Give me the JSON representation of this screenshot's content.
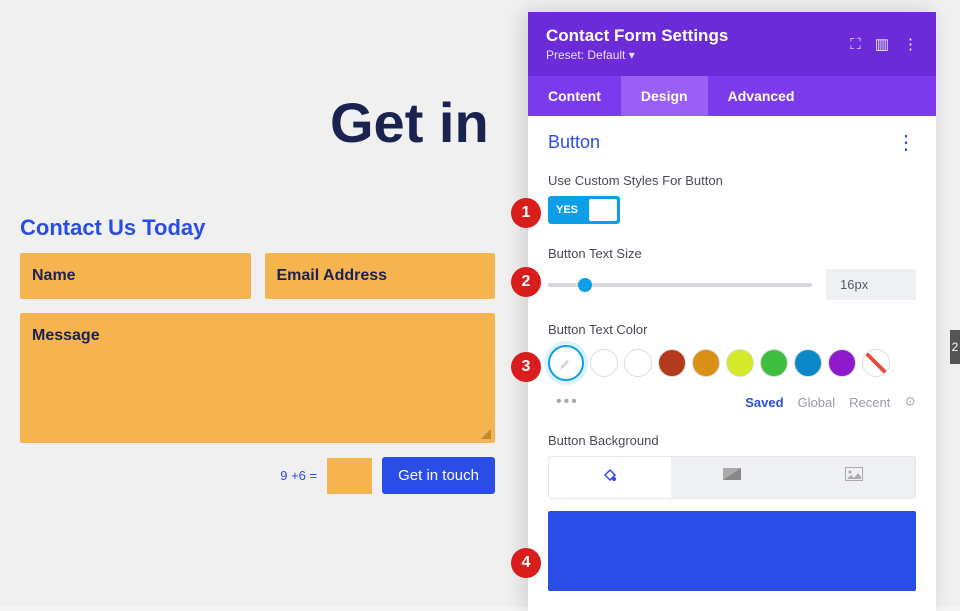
{
  "page": {
    "title": "Get in",
    "heading": "Contact Us Today"
  },
  "form": {
    "name_placeholder": "Name",
    "email_placeholder": "Email Address",
    "message_placeholder": "Message",
    "captcha_label": "9 +6 =",
    "submit_label": "Get in touch"
  },
  "panel": {
    "title": "Contact Form Settings",
    "preset": "Preset: Default ▾",
    "tabs": {
      "content": "Content",
      "design": "Design",
      "advanced": "Advanced"
    },
    "section": "Button",
    "custom_styles_label": "Use Custom Styles For Button",
    "toggle_yes": "YES",
    "text_size_label": "Button Text Size",
    "text_size_value": "16px",
    "text_color_label": "Button Text Color",
    "palette_tabs": {
      "saved": "Saved",
      "global": "Global",
      "recent": "Recent"
    },
    "bg_label": "Button Background",
    "colors": {
      "black": "#000000",
      "white": "#ffffff",
      "brick": "#b33a1d",
      "amber": "#d99015",
      "lime": "#d4e92a",
      "green": "#3fbf3f",
      "teal": "#0c88c9",
      "purple": "#8e1acb"
    }
  },
  "annotations": {
    "a1": "1",
    "a2": "2",
    "a3": "3",
    "a4": "4"
  },
  "edge": "2"
}
